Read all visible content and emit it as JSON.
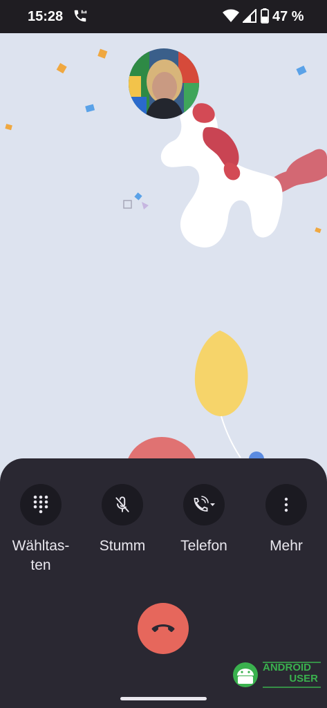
{
  "status_bar": {
    "time": "15:28",
    "battery_percent": "47 %",
    "battery_level": 0.47,
    "icons": [
      "call-active-icon",
      "wifi-icon",
      "signal-icon",
      "battery-icon"
    ]
  },
  "call": {
    "controls": [
      {
        "label": "Wähltasten",
        "icon": "dialpad-icon"
      },
      {
        "label": "Stumm",
        "icon": "mic-off-icon"
      },
      {
        "label": "Telefon",
        "icon": "phone-audio-route-icon"
      },
      {
        "label": "Mehr",
        "icon": "more-vert-icon"
      }
    ],
    "hangup_icon": "call-end-icon",
    "colors": {
      "panel": "#2a2832",
      "hangup": "#e6675c",
      "background": "#dde3ef"
    }
  },
  "watermark": {
    "line1": "ANDROID",
    "line2": "USER"
  }
}
